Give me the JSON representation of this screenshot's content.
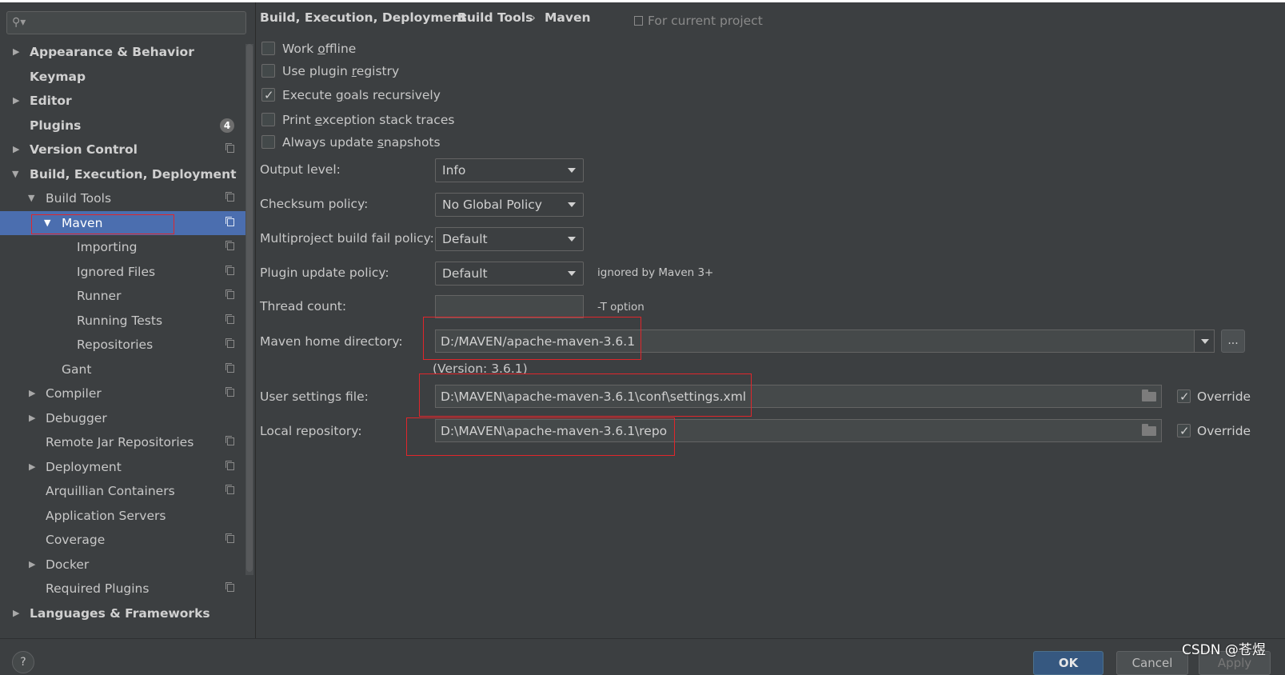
{
  "search": {
    "placeholder": ""
  },
  "sidebar": {
    "items": [
      {
        "label": "Appearance & Behavior"
      },
      {
        "label": "Keymap"
      },
      {
        "label": "Editor"
      },
      {
        "label": "Plugins",
        "badge": "4"
      },
      {
        "label": "Version Control"
      },
      {
        "label": "Build, Execution, Deployment"
      },
      {
        "label": "Build Tools"
      },
      {
        "label": "Maven"
      },
      {
        "label": "Importing"
      },
      {
        "label": "Ignored Files"
      },
      {
        "label": "Runner"
      },
      {
        "label": "Running Tests"
      },
      {
        "label": "Repositories"
      },
      {
        "label": "Gant"
      },
      {
        "label": "Compiler"
      },
      {
        "label": "Debugger"
      },
      {
        "label": "Remote Jar Repositories"
      },
      {
        "label": "Deployment"
      },
      {
        "label": "Arquillian Containers"
      },
      {
        "label": "Application Servers"
      },
      {
        "label": "Coverage"
      },
      {
        "label": "Docker"
      },
      {
        "label": "Required Plugins"
      },
      {
        "label": "Languages & Frameworks"
      }
    ]
  },
  "breadcrumb": {
    "items": [
      "Build, Execution, Deployment",
      "Build Tools",
      "Maven"
    ],
    "separator": "›",
    "scope": "For current project"
  },
  "options": {
    "work_offline": {
      "pre": "Work ",
      "mnemonic": "o",
      "post": "ffline",
      "checked": false
    },
    "use_plugin_registry": {
      "pre": "Use plugin ",
      "mnemonic": "r",
      "post": "egistry",
      "checked": false
    },
    "execute_goals_recursively": {
      "pre": "Execute ",
      "mnemonic": "g",
      "post": "oals recursively",
      "checked": true
    },
    "print_exception_stack_traces": {
      "pre": "Print ",
      "mnemonic": "e",
      "post": "xception stack traces",
      "checked": false
    },
    "always_update_snapshots": {
      "pre": "Always update ",
      "mnemonic": "s",
      "post": "napshots",
      "checked": false
    }
  },
  "fields": {
    "output_level": {
      "label": "Output level:",
      "value": "Info"
    },
    "checksum_policy": {
      "label": "Checksum policy:",
      "value": "No Global Policy"
    },
    "multiproject_fail_policy": {
      "label": "Multiproject build fail policy:",
      "value": "Default"
    },
    "plugin_update_policy": {
      "label": "Plugin update policy:",
      "value": "Default",
      "hint": "ignored by Maven 3+"
    },
    "thread_count": {
      "label": "Thread count:",
      "value": "",
      "hint": "-T option"
    },
    "maven_home": {
      "label": "Maven home directory:",
      "value": "D:/MAVEN/apache-maven-3.6.1",
      "browse": "...",
      "version": "(Version: 3.6.1)"
    },
    "user_settings": {
      "label": "User settings file:",
      "value": "D:\\MAVEN\\apache-maven-3.6.1\\conf\\settings.xml",
      "override_label": "Override",
      "override_checked": true
    },
    "local_repository": {
      "label": "Local repository:",
      "value": "D:\\MAVEN\\apache-maven-3.6.1\\repo",
      "override_label": "Override",
      "override_checked": true
    }
  },
  "buttons": {
    "help": "?",
    "ok": "OK",
    "cancel": "Cancel",
    "apply": "Apply"
  },
  "watermark": "CSDN @苍煜",
  "colors": {
    "selection": "#4b6eaf",
    "highlight_box": "#e0262b",
    "background": "#3c3f41",
    "primary_button": "#365880"
  },
  "icons": [
    "search-icon",
    "expand-arrow-icon",
    "collapse-arrow-icon",
    "project-scope-icon",
    "checkbox-check-icon",
    "dropdown-arrow-icon",
    "folder-icon"
  ]
}
